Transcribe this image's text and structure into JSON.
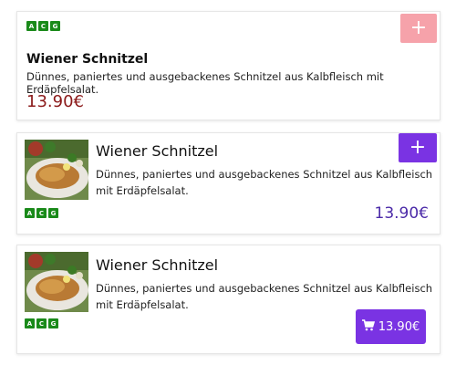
{
  "colors": {
    "add_button_inactive": "#f6a2aa",
    "add_button_active": "#7a33e3",
    "price_red": "#8b1a1a",
    "price_purple": "#4b2aa8",
    "allergen_badge": "#1a8a1a"
  },
  "cards": [
    {
      "allergens": [
        "A",
        "C",
        "G"
      ],
      "title": "Wiener Schnitzel",
      "description": "Dünnes, paniertes und ausgebackenes Schnitzel aus Kalbfleisch mit Erdäpfelsalat.",
      "price": "13.90€",
      "add_button": {
        "icon": "plus-icon",
        "label": "+"
      }
    },
    {
      "allergens": [
        "A",
        "C",
        "G"
      ],
      "title": "Wiener Schnitzel",
      "description": "Dünnes, paniertes und ausgebackenes Schnitzel aus Kalbfleisch mit Erdäpfelsalat.",
      "price": "13.90€",
      "image": "schnitzel-photo",
      "add_button": {
        "icon": "plus-icon",
        "label": "+"
      }
    },
    {
      "allergens": [
        "A",
        "C",
        "G"
      ],
      "title": "Wiener Schnitzel",
      "description": "Dünnes, paniertes und ausgebackenes Schnitzel aus Kalbfleisch mit Erdäpfelsalat.",
      "image": "schnitzel-photo",
      "cart_button": {
        "icon": "cart-icon",
        "label": "13.90€"
      }
    }
  ]
}
